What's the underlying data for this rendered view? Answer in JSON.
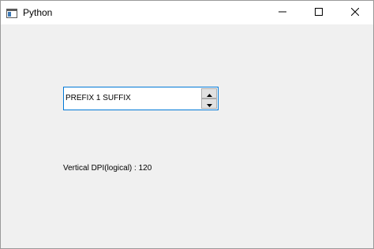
{
  "window": {
    "title": "Python",
    "icons": {
      "app": "python-window-icon",
      "minimize": "minimize-icon",
      "maximize": "maximize-icon",
      "close": "close-icon"
    }
  },
  "spinbox": {
    "display_text": "PREFIX 1 SUFFIX",
    "prefix": "PREFIX ",
    "value": 1,
    "suffix": " SUFFIX",
    "up_icon": "arrow-up-icon",
    "down_icon": "arrow-down-icon",
    "focus_color": "#0078d7"
  },
  "label": {
    "text": "Vertical DPI(logical) : 120"
  }
}
